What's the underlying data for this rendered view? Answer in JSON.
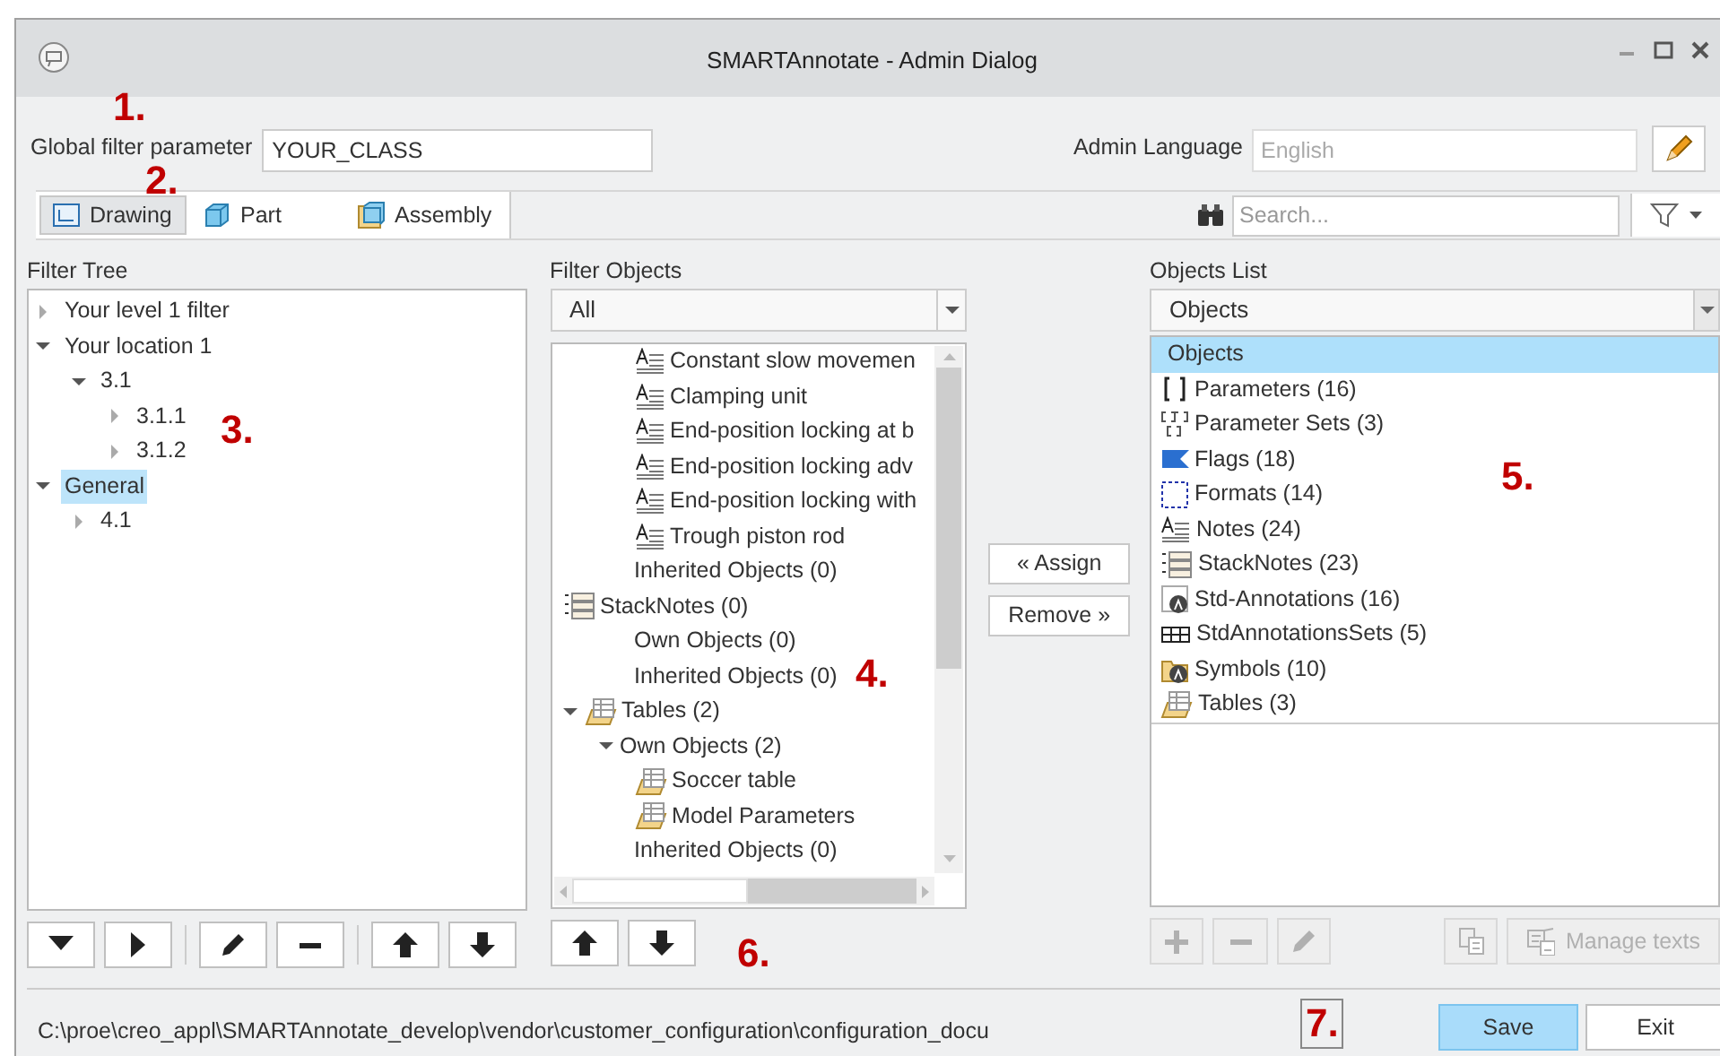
{
  "window": {
    "title": "SMARTAnnotate - Admin Dialog"
  },
  "global_filter": {
    "label": "Global filter parameter",
    "value": "YOUR_CLASS"
  },
  "admin_language": {
    "label": "Admin Language",
    "placeholder": "English"
  },
  "tabs": [
    {
      "label": "Drawing",
      "kind": "drawing",
      "selected": true
    },
    {
      "label": "Part",
      "kind": "part",
      "selected": false
    },
    {
      "label": "Assembly",
      "kind": "assembly",
      "selected": false
    }
  ],
  "search": {
    "placeholder": "Search..."
  },
  "filter_tree": {
    "title": "Filter Tree",
    "items": [
      {
        "label": "Your level 1 filter",
        "expanded": false,
        "selected": false
      },
      {
        "label": "Your location 1",
        "expanded": true,
        "selected": false,
        "children": [
          {
            "label": "3.1",
            "expanded": true,
            "selected": false,
            "children": [
              {
                "label": "3.1.1",
                "expanded": false,
                "selected": false
              },
              {
                "label": "3.1.2",
                "expanded": false,
                "selected": false
              }
            ]
          }
        ]
      },
      {
        "label": "General",
        "expanded": true,
        "selected": true,
        "children": [
          {
            "label": "4.1",
            "expanded": false,
            "selected": false
          }
        ]
      }
    ]
  },
  "filter_objects": {
    "title": "Filter Objects",
    "dropdown": "All",
    "items": [
      {
        "children": [
          {
            "children": [
              {
                "label": "Constant slow movemen",
                "kind": "note"
              },
              {
                "label": "Clamping unit",
                "kind": "note"
              },
              {
                "label": "End-position locking at b",
                "kind": "note"
              },
              {
                "label": "End-position locking adv",
                "kind": "note"
              },
              {
                "label": "End-position locking with",
                "kind": "note"
              },
              {
                "label": "Trough piston rod",
                "kind": "note"
              }
            ]
          },
          {
            "label": "Inherited Objects (0)"
          }
        ]
      },
      {
        "label": "StackNotes (0)",
        "kind": "stacknote",
        "children": [
          {
            "label": "Own Objects (0)"
          },
          {
            "label": "Inherited Objects (0)"
          }
        ]
      },
      {
        "label": "Tables (2)",
        "kind": "table",
        "expanded": true,
        "children": [
          {
            "label": "Own Objects (2)",
            "expanded": true,
            "children": [
              {
                "label": "Soccer table",
                "kind": "table"
              },
              {
                "label": "Model Parameters",
                "kind": "table"
              }
            ]
          },
          {
            "label": "Inherited Objects (0)"
          }
        ]
      }
    ]
  },
  "assign_buttons": [
    "« Assign",
    "Remove »"
  ],
  "objects_list": {
    "title": "Objects List",
    "dropdown": "Objects",
    "items": [
      {
        "label": "Objects",
        "kind": "header",
        "selected": true
      },
      {
        "label": "Parameters (16)",
        "kind": "param",
        "selected": false
      },
      {
        "label": "Parameter Sets (3)",
        "kind": "paramset",
        "selected": false
      },
      {
        "label": "Flags (18)",
        "kind": "flag",
        "selected": false
      },
      {
        "label": "Formats (14)",
        "kind": "format",
        "selected": false
      },
      {
        "label": "Notes (24)",
        "kind": "note",
        "selected": false
      },
      {
        "label": "StackNotes (23)",
        "kind": "stacknote",
        "selected": false
      },
      {
        "label": "Std-Annotations (16)",
        "kind": "stdann",
        "selected": false
      },
      {
        "label": "StdAnnotationsSets (5)",
        "kind": "stdannset",
        "selected": false
      },
      {
        "label": "Symbols (10)",
        "kind": "symbol",
        "selected": false
      },
      {
        "label": "Tables (3)",
        "kind": "table",
        "selected": false
      }
    ]
  },
  "tree_toolbar": [
    {
      "kind": "caret-down",
      "disabled": false
    },
    {
      "kind": "caret-right",
      "disabled": false
    },
    {
      "kind": "sep"
    },
    {
      "kind": "pencil",
      "disabled": false
    },
    {
      "kind": "minus",
      "disabled": false
    },
    {
      "kind": "sep"
    },
    {
      "kind": "up",
      "disabled": false
    },
    {
      "kind": "down",
      "disabled": false
    }
  ],
  "objects_toolbar": [
    {
      "kind": "up",
      "disabled": false
    },
    {
      "kind": "down",
      "disabled": false
    }
  ],
  "list_toolbar": [
    {
      "kind": "plus",
      "disabled": true
    },
    {
      "kind": "minus",
      "disabled": true
    },
    {
      "kind": "pencil",
      "disabled": true
    },
    {
      "kind": "gap"
    },
    {
      "kind": "copy",
      "disabled": true
    },
    {
      "kind": "manage",
      "label": "Manage texts",
      "disabled": true
    }
  ],
  "status_path": "C:\\proe\\creo_appl\\SMARTAnnotate_develop\\vendor\\customer_configuration\\configuration_docu",
  "footer_buttons": [
    {
      "label": "Save",
      "primary": true
    },
    {
      "label": "Exit",
      "primary": false
    }
  ],
  "callouts": [
    {
      "label": "1.",
      "boxed": false
    },
    {
      "label": "2.",
      "boxed": false
    },
    {
      "label": "3.",
      "boxed": false
    },
    {
      "label": "4.",
      "boxed": false
    },
    {
      "label": "5.",
      "boxed": false
    },
    {
      "label": "6.",
      "boxed": false
    },
    {
      "label": "7.",
      "boxed": true
    }
  ]
}
